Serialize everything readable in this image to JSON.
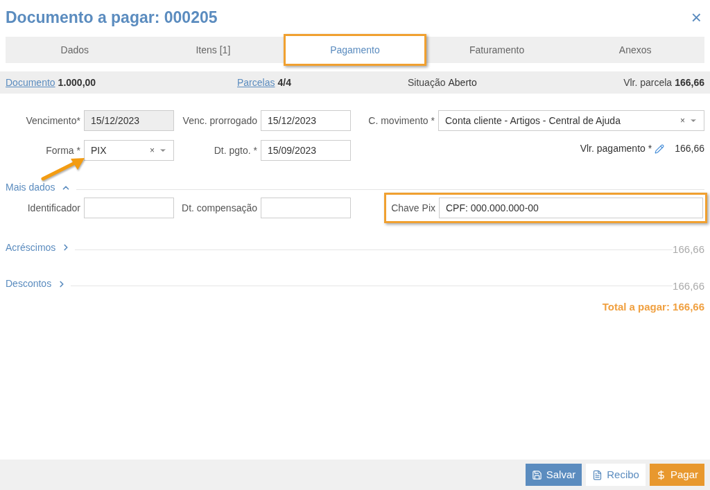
{
  "title": "Documento a pagar: 000205",
  "close": "×",
  "tabs": [
    {
      "label": "Dados",
      "selected": false,
      "highlighted": false
    },
    {
      "label": "Itens [1]",
      "selected": false,
      "highlighted": false
    },
    {
      "label": "Pagamento",
      "selected": true,
      "highlighted": true
    },
    {
      "label": "Faturamento",
      "selected": false,
      "highlighted": false
    },
    {
      "label": "Anexos",
      "selected": false,
      "highlighted": false
    }
  ],
  "summary": [
    {
      "kind": "link",
      "label": "Documento",
      "value": "1.000,00",
      "value_bold": true
    },
    {
      "kind": "link",
      "label": "Parcelas",
      "value": "4/4",
      "value_bold": true
    },
    {
      "kind": "text",
      "label": "Situação",
      "value": "Aberto",
      "value_bold": false
    },
    {
      "kind": "text",
      "label": "Vlr. parcela",
      "value": "166,66",
      "value_bold": true
    }
  ],
  "vencimento": {
    "label": "Vencimento*",
    "value": "15/12/2023",
    "disabled": true
  },
  "venc_prorrogado": {
    "label": "Venc. prorrogado",
    "value": "15/12/2023",
    "disabled": false
  },
  "c_movimento": {
    "label": "C. movimento *",
    "value": "Conta cliente - Artigos - Central de Ajuda",
    "clear": "×"
  },
  "forma": {
    "label": "Forma *",
    "value": "PIX",
    "clear": "×"
  },
  "dt_pgto": {
    "label": "Dt. pgto. *",
    "value": "15/09/2023",
    "disabled": false
  },
  "vlr_pagamento": {
    "label": "Vlr. pagamento *",
    "value": "166,66"
  },
  "mais_dados": {
    "label": "Mais dados",
    "expanded": true
  },
  "identificador": {
    "label": "Identificador",
    "disabled": false
  },
  "dt_compensacao": {
    "label": "Dt. compensação",
    "disabled": false
  },
  "chave_pix": {
    "label": "Chave Pix",
    "value": "CPF: 000.000.000-00",
    "highlighted": true
  },
  "sections": [
    {
      "label": "Acréscimos",
      "expanded": false,
      "amount": "166,66"
    },
    {
      "label": "Descontos",
      "expanded": false,
      "amount": "166,66"
    }
  ],
  "total": "Total a pagar: 166,66",
  "buttons": [
    {
      "kind": "save",
      "label": "Salvar"
    },
    {
      "kind": "receipt",
      "label": "Recibo"
    },
    {
      "kind": "pay",
      "label": "Pagar"
    }
  ]
}
